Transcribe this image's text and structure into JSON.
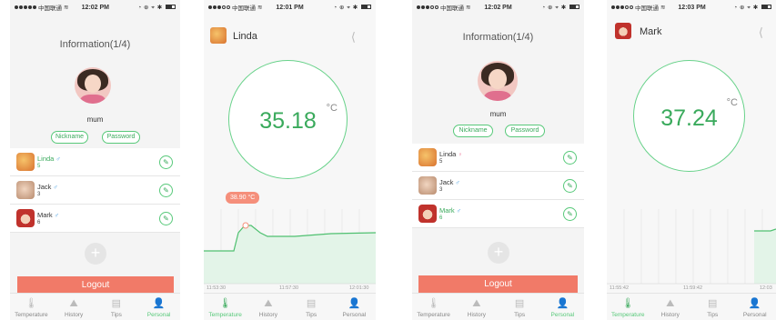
{
  "status_bar": {
    "carrier": "中国联通",
    "screen1_time": "12:02 PM",
    "screen2_time": "12:01 PM",
    "screen3_time": "12:02 PM",
    "screen4_time": "12:03 PM"
  },
  "info_screen": {
    "title": "Information(1/4)",
    "nickname_display": "mum",
    "nickname_button": "Nickname",
    "password_button": "Password",
    "members": [
      {
        "name": "Linda",
        "value": "5"
      },
      {
        "name": "Jack",
        "value": "3"
      },
      {
        "name": "Mark",
        "value": "6"
      }
    ],
    "members_screen3": [
      {
        "name": "Linda",
        "value": "5"
      },
      {
        "name": "Jack",
        "value": "3"
      },
      {
        "name": "Mark",
        "value": "6"
      }
    ],
    "add_label": "+",
    "logout_label": "Logout"
  },
  "temperature_screen_linda": {
    "name": "Linda",
    "reading": "35.18",
    "unit": "°C",
    "tooltip": "38.90 °C",
    "x_ticks": [
      "11:53:30",
      "11:57:30",
      "12:01:30"
    ]
  },
  "temperature_screen_mark": {
    "name": "Mark",
    "reading": "37.24",
    "unit": "°C",
    "x_ticks": [
      "11:55:42",
      "11:59:42",
      "12:03"
    ]
  },
  "tabs": [
    "Temperature",
    "History",
    "Tips",
    "Personal"
  ],
  "colors": {
    "accent_green": "#58c97a",
    "logout": "#f17a68",
    "tooltip": "#f58f7b"
  },
  "icons": [
    "share-icon",
    "edit-icon",
    "thermometer-icon",
    "history-icon",
    "tips-icon",
    "person-icon"
  ]
}
